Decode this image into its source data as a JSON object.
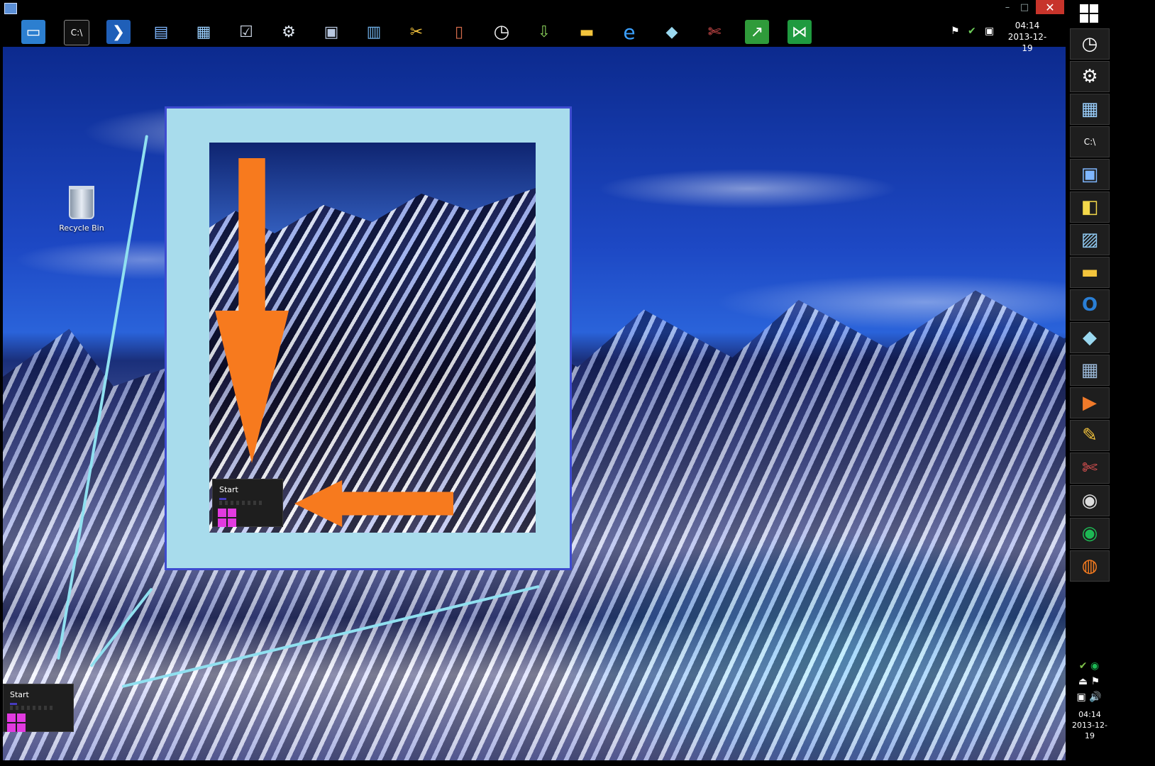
{
  "top_taskbar": {
    "icons": [
      "explorer-window-icon",
      "command-prompt-icon",
      "powershell-icon",
      "network-icon",
      "remote-desktop-icon",
      "task-checklist-icon",
      "gear-icon",
      "computer-tools-icon",
      "package-icon",
      "tools-icon",
      "device-icon",
      "clock-icon",
      "download-icon",
      "folder-icon",
      "internet-explorer-icon",
      "eraser-icon",
      "snipping-tool-icon",
      "performance-icon",
      "visual-studio-icon"
    ],
    "clock": {
      "time": "04:14",
      "date": "2013-12-19"
    }
  },
  "window_controls": {
    "minimize": "–",
    "maximize": "□",
    "close": "✕"
  },
  "right_taskbar": {
    "icons": [
      "clock-icon",
      "gear-icon",
      "network-icon",
      "command-prompt-icon",
      "computer-icon",
      "folder-icon",
      "picture-icon",
      "file-explorer-icon",
      "outlook-icon",
      "eraser-icon",
      "calculator-icon",
      "media-player-icon",
      "paint-icon",
      "snipping-tool-icon",
      "steam-icon",
      "spotify-icon",
      "firefox-icon"
    ],
    "clock": {
      "time": "04:14",
      "date": "2013-12-19"
    }
  },
  "desktop": {
    "recycle_bin_label": "Recycle Bin",
    "start_tile_label": "Start",
    "inset_start_tile_label": "Start"
  },
  "colors": {
    "accent": "#f77a1e",
    "frame_border": "#3e4bd0",
    "frame_fill": "#a8dcec",
    "start_logo": "#e23ae0",
    "close_button": "#c7342b"
  }
}
